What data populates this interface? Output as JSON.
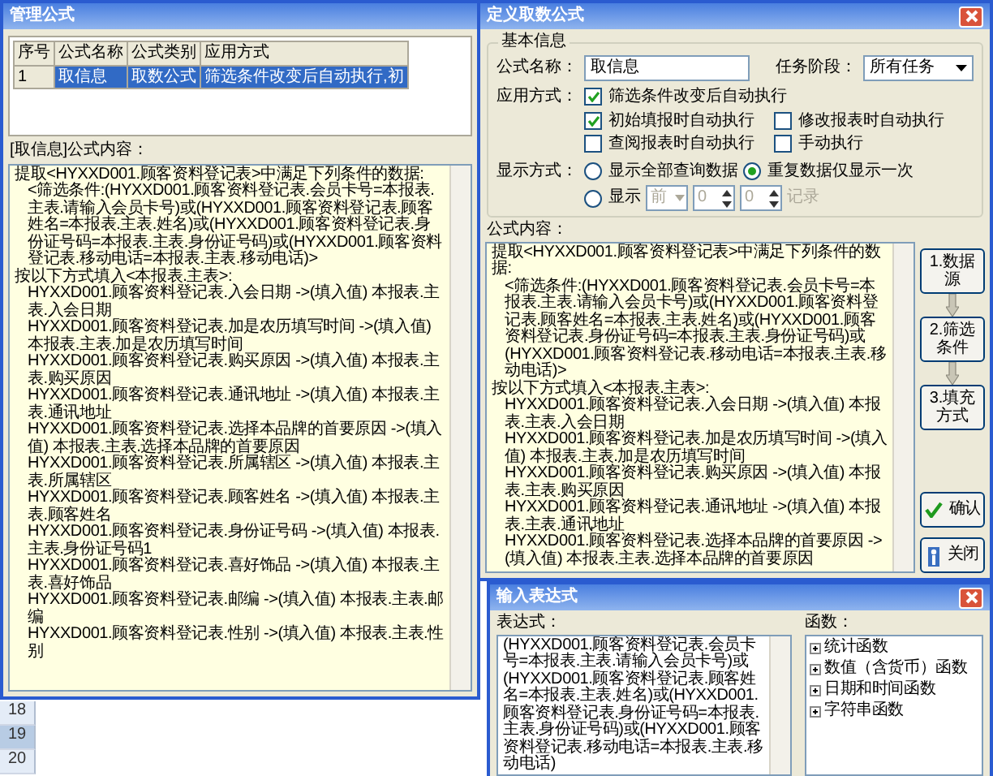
{
  "manage_window": {
    "title": "管理公式",
    "table": {
      "columns": [
        "序号",
        "公式名称",
        "公式类别",
        "应用方式"
      ],
      "rows": [
        {
          "cells": [
            "1",
            "取信息",
            "取数公式",
            "筛选条件改变后自动执行,初"
          ],
          "selected": true
        }
      ]
    },
    "content_label": "[取信息]公式内容：",
    "content_lines": [
      {
        "text": "提取<HYXXD001.顾客资料登记表>中满足下列条件的数据:",
        "indented": false
      },
      {
        "text": "<筛选条件:(HYXXD001.顾客资料登记表.会员卡号=本报表.主表.请输入会员卡号)或(HYXXD001.顾客资料登记表.顾客姓名=本报表.主表.姓名)或(HYXXD001.顾客资料登记表.身份证号码=本报表.主表.身份证号码)或(HYXXD001.顾客资料登记表.移动电话=本报表.主表.移动电话)>",
        "indented": true
      },
      {
        "text": "按以下方式填入<本报表.主表>:",
        "indented": false
      },
      {
        "text": "HYXXD001.顾客资料登记表.入会日期 ->(填入值) 本报表.主表.入会日期",
        "indented": true
      },
      {
        "text": "HYXXD001.顾客资料登记表.加是农历填写时间 ->(填入值) 本报表.主表.加是农历填写时间",
        "indented": true
      },
      {
        "text": "HYXXD001.顾客资料登记表.购买原因 ->(填入值) 本报表.主表.购买原因",
        "indented": true
      },
      {
        "text": "HYXXD001.顾客资料登记表.通讯地址 ->(填入值) 本报表.主表.通讯地址",
        "indented": true
      },
      {
        "text": "HYXXD001.顾客资料登记表.选择本品牌的首要原因 ->(填入值) 本报表.主表.选择本品牌的首要原因",
        "indented": true
      },
      {
        "text": "HYXXD001.顾客资料登记表.所属辖区 ->(填入值) 本报表.主表.所属辖区",
        "indented": true
      },
      {
        "text": "HYXXD001.顾客资料登记表.顾客姓名 ->(填入值) 本报表.主表.顾客姓名",
        "indented": true
      },
      {
        "text": "HYXXD001.顾客资料登记表.身份证号码 ->(填入值) 本报表.主表.身份证号码1",
        "indented": true
      },
      {
        "text": "HYXXD001.顾客资料登记表.喜好饰品 ->(填入值) 本报表.主表.喜好饰品",
        "indented": true
      },
      {
        "text": "HYXXD001.顾客资料登记表.邮编 ->(填入值) 本报表.主表.邮编",
        "indented": true
      },
      {
        "text": "HYXXD001.顾客资料登记表.性别 ->(填入值) 本报表.主表.性别",
        "indented": true
      }
    ]
  },
  "spreadsheet": {
    "rows": [
      {
        "label": "18",
        "selected": false
      },
      {
        "label": "19",
        "selected": true
      },
      {
        "label": "20",
        "selected": false
      }
    ]
  },
  "define_window": {
    "title": "定义取数公式",
    "group_title": "基本信息",
    "name_label": "公式名称：",
    "name_value": "取信息",
    "stage_label": "任务阶段：",
    "stage_value": "所有任务",
    "apply_label": "应用方式：",
    "apply_options": [
      {
        "label": "筛选条件改变后自动执行",
        "checked": true
      },
      {
        "label": "初始填报时自动执行",
        "checked": true
      },
      {
        "label": "修改报表时自动执行",
        "checked": false
      },
      {
        "label": "查阅报表时自动执行",
        "checked": false
      },
      {
        "label": "手动执行",
        "checked": false
      }
    ],
    "display_label": "显示方式：",
    "display_options": [
      {
        "label": "显示全部查询数据",
        "selected": false
      },
      {
        "label": "重复数据仅显示一次",
        "selected": true
      },
      {
        "label": "显示",
        "selected": false
      }
    ],
    "range_fields": [
      {
        "value": "前",
        "kind": "dropdown"
      },
      {
        "value": "0",
        "kind": "spinner"
      },
      {
        "value": "0",
        "kind": "spinner"
      }
    ],
    "range_disabled": true,
    "records_label": "记录",
    "content_label": "公式内容：",
    "content_lines": [
      {
        "text": "提取<HYXXD001.顾客资料登记表>中满足下列条件的数据:",
        "indented": false
      },
      {
        "text": "<筛选条件:(HYXXD001.顾客资料登记表.会员卡号=本报表.主表.请输入会员卡号)或(HYXXD001.顾客资料登记表.顾客姓名=本报表.主表.姓名)或(HYXXD001.顾客资料登记表.身份证号码=本报表.主表.身份证号码)或(HYXXD001.顾客资料登记表.移动电话=本报表.主表.移动电话)>",
        "indented": true
      },
      {
        "text": "按以下方式填入<本报表.主表>:",
        "indented": false
      },
      {
        "text": "HYXXD001.顾客资料登记表.入会日期 ->(填入值) 本报表.主表.入会日期",
        "indented": true
      },
      {
        "text": "HYXXD001.顾客资料登记表.加是农历填写时间 ->(填入值) 本报表.主表.加是农历填写时间",
        "indented": true
      },
      {
        "text": "HYXXD001.顾客资料登记表.购买原因 ->(填入值) 本报表.主表.购买原因",
        "indented": true
      },
      {
        "text": "HYXXD001.顾客资料登记表.通讯地址 ->(填入值) 本报表.主表.通讯地址",
        "indented": true
      },
      {
        "text": "HYXXD001.顾客资料登记表.选择本品牌的首要原因 ->(填入值) 本报表.主表.选择本品牌的首要原因",
        "indented": true
      }
    ],
    "steps": [
      "1.数据源",
      "2.筛选条件",
      "3.填充方式"
    ],
    "ok_button": "确认",
    "close_button": "关闭"
  },
  "expression_window": {
    "title": "输入表达式",
    "expression_label": "表达式：",
    "expression": "(HYXXD001.顾客资料登记表.会员卡号=本报表.主表.请输入会员卡号)或(HYXXD001.顾客资料登记表.顾客姓名=本报表.主表.姓名)或(HYXXD001.顾客资料登记表.身份证号码=本报表.主表.身份证号码)或(HYXXD001.顾客资料登记表.移动电话=本报表.主表.移动电话)",
    "functions_label": "函数：",
    "functions": [
      "统计函数",
      "数值（含货币）函数",
      "日期和时间函数",
      "字符串函数"
    ]
  }
}
